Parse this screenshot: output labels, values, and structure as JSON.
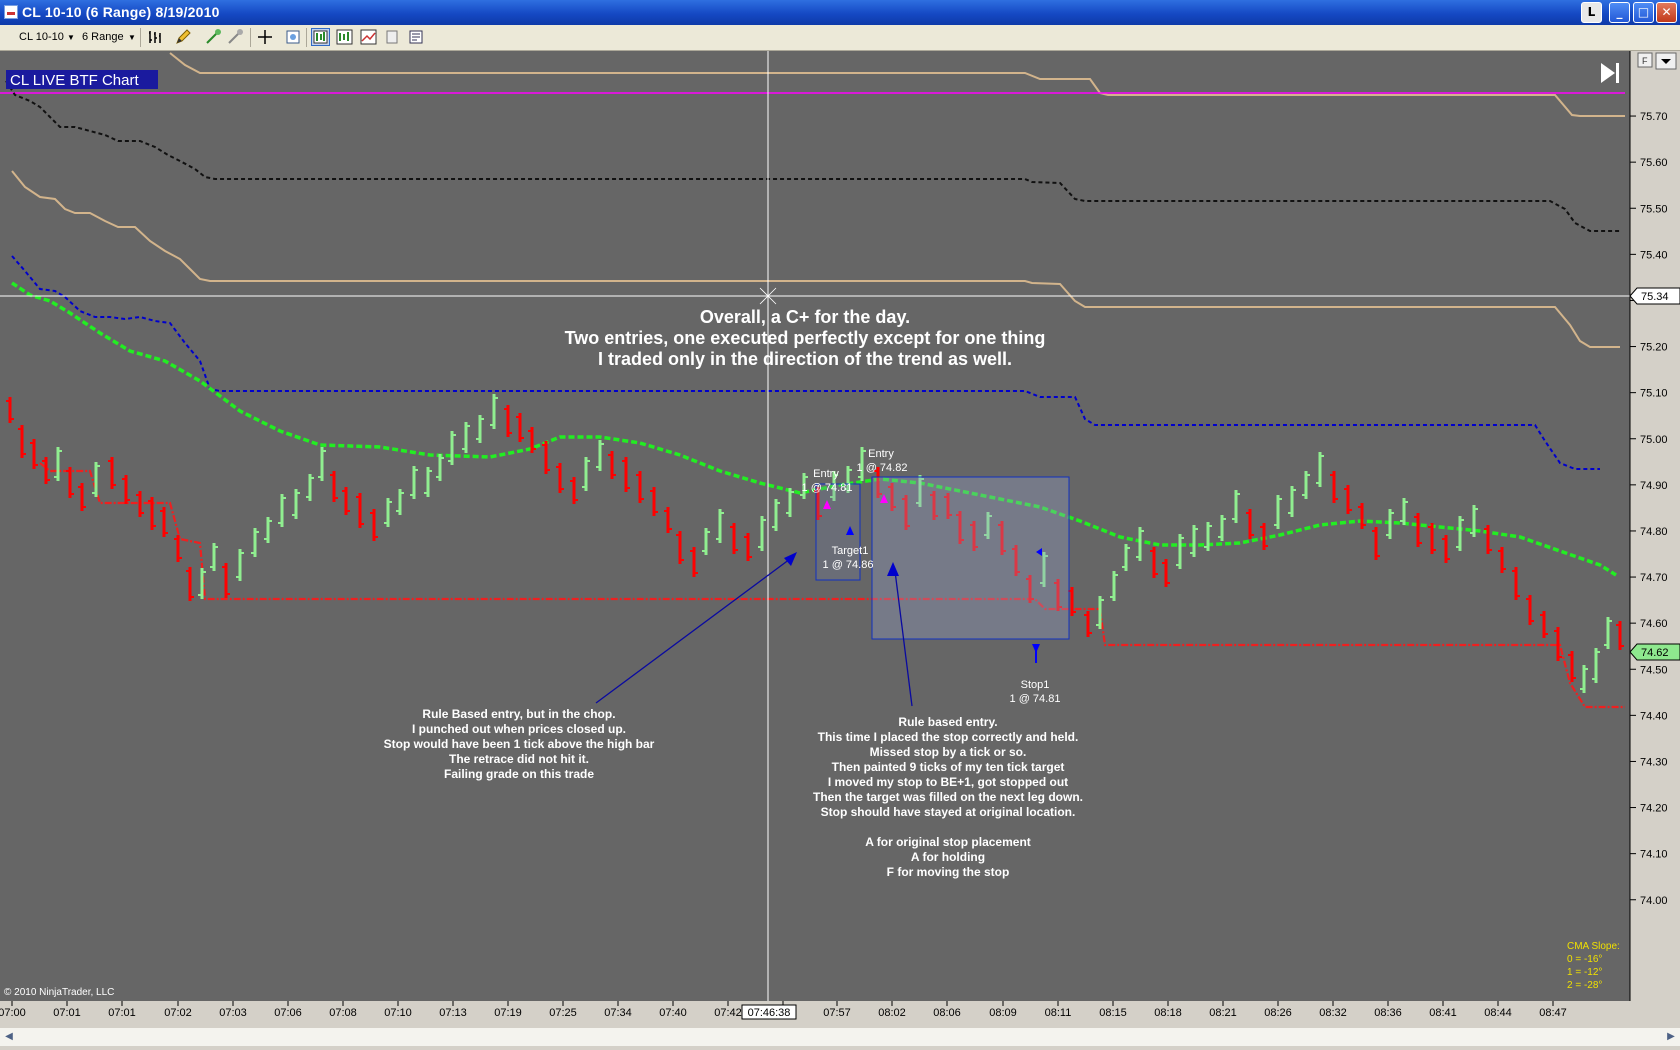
{
  "window": {
    "title": "CL 10-10 (6 Range)  8/19/2010",
    "buttons": {
      "l_label": "L",
      "min": "_",
      "max": "□",
      "close": "✕"
    }
  },
  "toolbar": {
    "instrument": "CL 10-10",
    "interval": "6 Range",
    "icons": [
      "bar-type-icon",
      "drawing-pencil-icon",
      "draw-tool-icon",
      "eraser-icon",
      "crosshair-icon",
      "zoom-icon",
      "chart-style-icon",
      "indicators-icon",
      "strategies-icon",
      "properties-icon",
      "data-box-icon"
    ]
  },
  "chart": {
    "label": "CL LIVE BTF Chart",
    "copyright": "© 2010 NinjaTrader, LLC",
    "colors": {
      "background": "#666666",
      "up_bar": "#90ee90",
      "down_bar": "#ff0000",
      "tan_line": "#d2b48c",
      "magenta_line": "#ff00ff",
      "black_line": "#111111",
      "blue_line": "#0000cc",
      "green_ma": "#22ee22",
      "red_stop": "#ee2020",
      "label_box": "#1a1a9e"
    },
    "price_labels": [
      "75.70",
      "75.60",
      "75.50",
      "75.40",
      "75.30",
      "75.20",
      "75.10",
      "75.00",
      "74.90",
      "74.80",
      "74.70",
      "74.60",
      "74.50",
      "74.40",
      "74.30",
      "74.20",
      "74.10",
      "74.00"
    ],
    "crosshair_price": "75.34",
    "last_price": "74.62",
    "time_labels": [
      "07:00",
      "07:01",
      "07:01",
      "07:02",
      "07:03",
      "07:06",
      "07:08",
      "07:10",
      "07:13",
      "07:19",
      "07:25",
      "07:34",
      "07:40",
      "07:42",
      "07:52",
      "07:57",
      "08:02",
      "08:06",
      "08:09",
      "08:11",
      "08:15",
      "08:18",
      "08:21",
      "08:26",
      "08:32",
      "08:36",
      "08:41",
      "08:44",
      "08:47"
    ],
    "crosshair_time": "07:46:38",
    "headline": [
      "Overall, a C+ for the day.",
      "Two entries, one executed perfectly except for one thing",
      "I traded only in the direction of the trend as well."
    ],
    "note_left": [
      "Rule Based entry, but in the chop.",
      "I punched out when prices closed up.",
      "Stop would have been 1 tick above the high bar",
      "The retrace did not hit it.",
      "Failing grade on this trade"
    ],
    "note_right": [
      "Rule based entry.",
      "This time I placed the stop correctly and held.",
      "Missed stop by a tick or so.",
      "Then painted 9 ticks of my ten tick target",
      "I moved my stop to BE+1, got stopped out",
      "Then the target was filled on the next leg down.",
      "Stop should have stayed at original location.",
      "",
      "A for original stop placement",
      "A for holding",
      "F for moving the stop"
    ],
    "markers": {
      "entry1": [
        "Entry",
        "1 @ 74.81"
      ],
      "target1": [
        "Target1",
        "1 @ 74.86"
      ],
      "entry2": [
        "Entry",
        "1 @ 74.82"
      ],
      "stop1": [
        "Stop1",
        "1 @ 74.81"
      ]
    },
    "cma_slope": [
      "CMA Slope:",
      "0 = -16°",
      "1 = -12°",
      "2 = -28°"
    ]
  }
}
